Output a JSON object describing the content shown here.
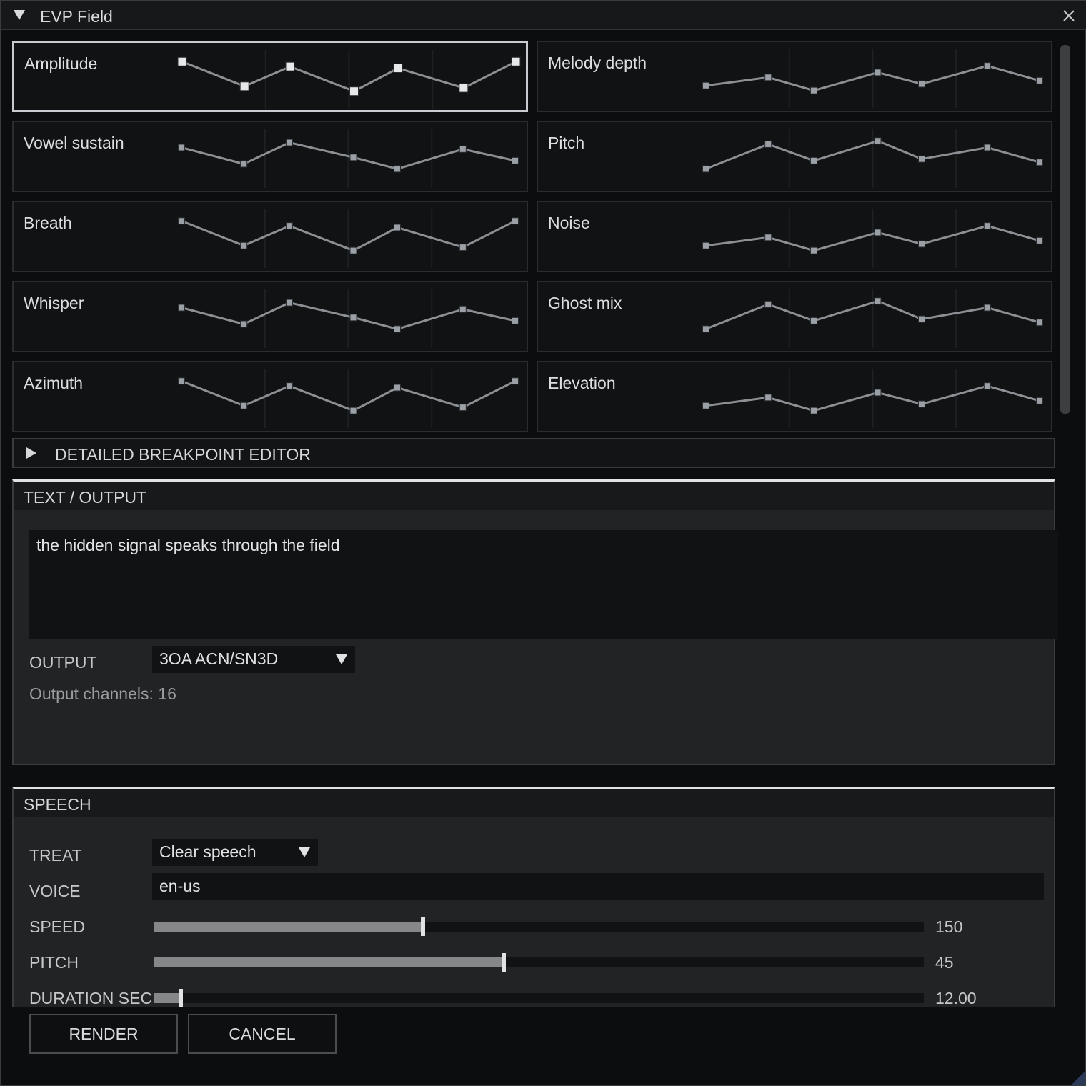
{
  "window": {
    "title": "EVP Field",
    "collapse_icon": "triangle-down-icon",
    "close_icon": "close-icon"
  },
  "envelopes": [
    {
      "label": "Amplitude",
      "points": [
        0.95,
        0.2,
        0.8,
        0.05,
        0.75,
        0.15,
        0.95
      ]
    },
    {
      "label": "Melody depth",
      "points": [
        0.2,
        0.45,
        0.05,
        0.6,
        0.25,
        0.8,
        0.35
      ]
    },
    {
      "label": "Vowel sustain",
      "points": [
        0.75,
        0.25,
        0.9,
        0.45,
        0.1,
        0.7,
        0.35
      ]
    },
    {
      "label": "Pitch",
      "points": [
        0.1,
        0.85,
        0.35,
        0.95,
        0.4,
        0.75,
        0.3
      ]
    },
    {
      "label": "Breath",
      "points": [
        0.95,
        0.2,
        0.8,
        0.05,
        0.75,
        0.15,
        0.95
      ]
    },
    {
      "label": "Noise",
      "points": [
        0.2,
        0.45,
        0.05,
        0.6,
        0.25,
        0.8,
        0.35
      ]
    },
    {
      "label": "Whisper",
      "points": [
        0.75,
        0.25,
        0.9,
        0.45,
        0.1,
        0.7,
        0.35
      ]
    },
    {
      "label": "Ghost mix",
      "points": [
        0.1,
        0.85,
        0.35,
        0.95,
        0.4,
        0.75,
        0.3
      ]
    },
    {
      "label": "Azimuth",
      "points": [
        0.95,
        0.2,
        0.8,
        0.05,
        0.75,
        0.15,
        0.95
      ]
    },
    {
      "label": "Elevation",
      "points": [
        0.2,
        0.45,
        0.05,
        0.6,
        0.25,
        0.8,
        0.35
      ]
    }
  ],
  "breakpoint_editor": {
    "label": "DETAILED BREAKPOINT EDITOR",
    "icon": "triangle-right-icon"
  },
  "text_output": {
    "header": "TEXT / OUTPUT",
    "text": "the hidden signal speaks through the field",
    "output_label": "OUTPUT",
    "output_value": "3OA ACN/SN3D",
    "channels_info": "Output channels: 16"
  },
  "speech": {
    "header": "SPEECH",
    "treat_label": "TREAT",
    "treat_value": "Clear speech",
    "voice_label": "VOICE",
    "voice_value": "en-us",
    "speed_label": "SPEED",
    "speed_value": "150",
    "speed_fraction": 0.35,
    "pitch_label": "PITCH",
    "pitch_value": "45",
    "pitch_fraction": 0.455,
    "duration_label": "DURATION SEC",
    "duration_value": "12.00",
    "duration_fraction": 0.035
  },
  "buttons": {
    "render": "RENDER",
    "cancel": "CANCEL"
  },
  "colors": {
    "accent": "#e0e2e4",
    "graph_line": "#8c9094",
    "graph_node": "#9aa0a6"
  }
}
